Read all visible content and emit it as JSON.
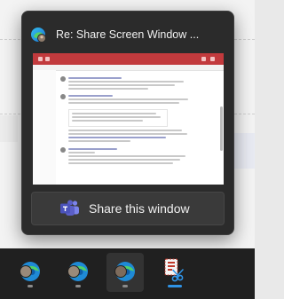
{
  "popup": {
    "title": "Re: Share Screen Window ...",
    "share_button_label": "Share this window",
    "app_icon": "edge-profile-icon",
    "share_icon": "teams-icon"
  },
  "taskbar": {
    "items": [
      {
        "icon": "edge-icon",
        "selected": false
      },
      {
        "icon": "edge-icon",
        "selected": false
      },
      {
        "icon": "edge-icon",
        "selected": true
      },
      {
        "icon": "snipping-tool-icon",
        "selected": false,
        "active": true
      }
    ]
  },
  "colors": {
    "popup_bg": "#2b2b2b",
    "taskbar_bg": "#202020",
    "accent": "#2f93e6",
    "teams_purple": "#5b5fc7",
    "thumbnail_header": "#c23a3d"
  }
}
